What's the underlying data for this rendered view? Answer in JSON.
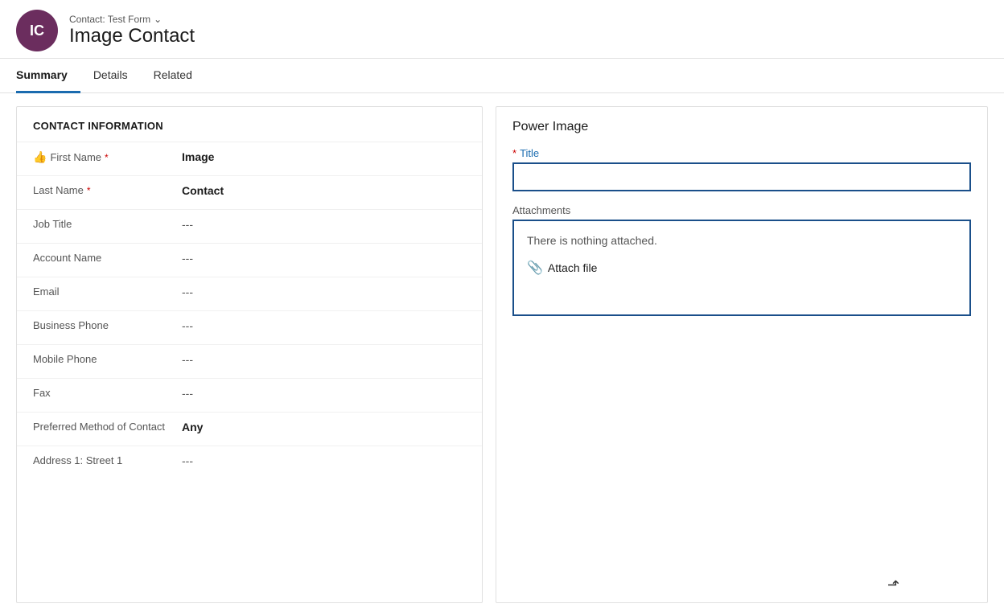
{
  "header": {
    "avatar_initials": "IC",
    "avatar_bg": "#6b2d5e",
    "contact_form_label": "Contact: Test Form",
    "contact_name": "Image Contact"
  },
  "tabs": [
    {
      "id": "summary",
      "label": "Summary",
      "active": true
    },
    {
      "id": "details",
      "label": "Details",
      "active": false
    },
    {
      "id": "related",
      "label": "Related",
      "active": false
    }
  ],
  "left_panel": {
    "section_title": "CONTACT INFORMATION",
    "fields": [
      {
        "label": "First Name",
        "required": true,
        "value": "Image",
        "bold": true,
        "has_thumb": true,
        "empty": false
      },
      {
        "label": "Last Name",
        "required": true,
        "value": "Contact",
        "bold": true,
        "has_thumb": false,
        "empty": false
      },
      {
        "label": "Job Title",
        "required": false,
        "value": "---",
        "bold": false,
        "has_thumb": false,
        "empty": true
      },
      {
        "label": "Account Name",
        "required": false,
        "value": "---",
        "bold": false,
        "has_thumb": false,
        "empty": true
      },
      {
        "label": "Email",
        "required": false,
        "value": "---",
        "bold": false,
        "has_thumb": false,
        "empty": true
      },
      {
        "label": "Business Phone",
        "required": false,
        "value": "---",
        "bold": false,
        "has_thumb": false,
        "empty": true
      },
      {
        "label": "Mobile Phone",
        "required": false,
        "value": "---",
        "bold": false,
        "has_thumb": false,
        "empty": true
      },
      {
        "label": "Fax",
        "required": false,
        "value": "---",
        "bold": false,
        "has_thumb": false,
        "empty": true
      },
      {
        "label": "Preferred Method of Contact",
        "required": false,
        "value": "Any",
        "bold": true,
        "has_thumb": false,
        "empty": false
      },
      {
        "label": "Address 1: Street 1",
        "required": false,
        "value": "---",
        "bold": false,
        "has_thumb": false,
        "empty": true
      }
    ]
  },
  "right_panel": {
    "title": "Power Image",
    "title_field_label": "Title",
    "title_required": true,
    "title_value": "",
    "attachments_label": "Attachments",
    "nothing_attached_text": "There is nothing attached.",
    "attach_file_label": "Attach file"
  },
  "icons": {
    "chevron": "⌄",
    "thumb": "👍",
    "paperclip": "📎"
  }
}
